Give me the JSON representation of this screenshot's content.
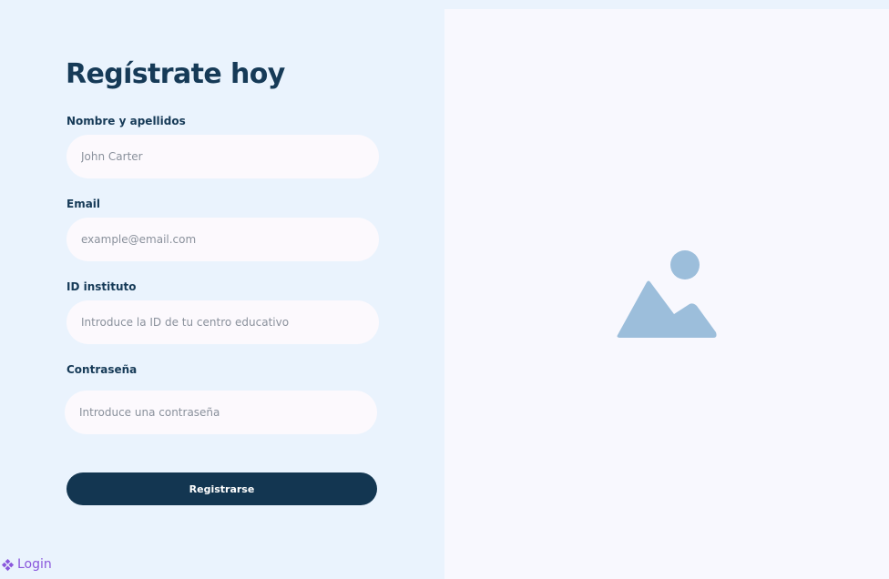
{
  "form": {
    "title": "Regístrate hoy",
    "fields": [
      {
        "label": "Nombre y apellidos",
        "placeholder": "John Carter"
      },
      {
        "label": "Email",
        "placeholder": "example@email.com"
      },
      {
        "label": "ID instituto",
        "placeholder": "Introduce la ID de tu centro educativo"
      },
      {
        "label": "Contraseña",
        "placeholder": "Introduce una contraseña"
      }
    ],
    "submit_label": "Registrarse"
  },
  "footer": {
    "login_label": "Login",
    "login_icon": "component-diamond-icon"
  },
  "hero": {
    "image_icon": "image-placeholder-icon"
  },
  "colors": {
    "left_background": "#eaf3fd",
    "right_background": "#f8f8fe",
    "primary": "#133651",
    "input_background": "#fcf9fd",
    "link": "#8a57dc",
    "placeholder_icon": "#9cbedb"
  }
}
